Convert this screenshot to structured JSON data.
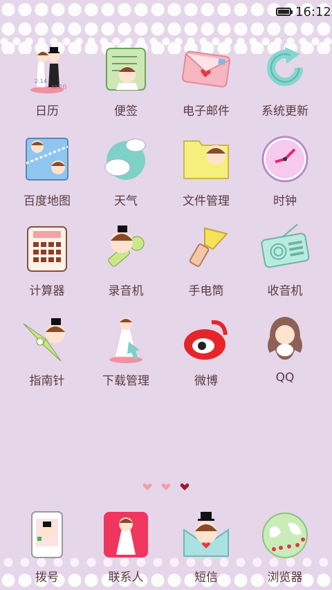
{
  "status_bar": {
    "time": "16:12",
    "battery_icon": "battery-icon"
  },
  "colors": {
    "background": "#e6d6ea",
    "text": "#5a3b3f",
    "heart_active": "#c0392b",
    "heart_inactive": "#f2a0a6"
  },
  "apps": [
    {
      "label": "日历",
      "icon": "calendar-icon"
    },
    {
      "label": "便签",
      "icon": "notes-icon"
    },
    {
      "label": "电子邮件",
      "icon": "email-icon"
    },
    {
      "label": "系统更新",
      "icon": "system-update-icon"
    },
    {
      "label": "百度地图",
      "icon": "baidu-map-icon"
    },
    {
      "label": "天气",
      "icon": "weather-icon"
    },
    {
      "label": "文件管理",
      "icon": "file-manager-icon"
    },
    {
      "label": "时钟",
      "icon": "clock-icon"
    },
    {
      "label": "计算器",
      "icon": "calculator-icon"
    },
    {
      "label": "录音机",
      "icon": "recorder-icon"
    },
    {
      "label": "手电筒",
      "icon": "flashlight-icon"
    },
    {
      "label": "收音机",
      "icon": "radio-icon"
    },
    {
      "label": "指南针",
      "icon": "compass-icon"
    },
    {
      "label": "下载管理",
      "icon": "download-manager-icon"
    },
    {
      "label": "微博",
      "icon": "weibo-icon"
    },
    {
      "label": "QQ",
      "icon": "qq-icon"
    }
  ],
  "calendar_text": {
    "date_left": "2.14",
    "date_right": "12月日"
  },
  "page_indicator": {
    "pages": 3,
    "active_index": 2
  },
  "dock": [
    {
      "label": "拨号",
      "icon": "dialer-icon"
    },
    {
      "label": "联系人",
      "icon": "contacts-icon"
    },
    {
      "label": "短信",
      "icon": "messages-icon"
    },
    {
      "label": "浏览器",
      "icon": "browser-icon"
    }
  ]
}
